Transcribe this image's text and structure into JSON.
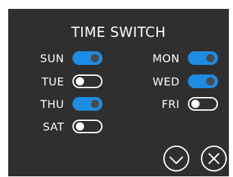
{
  "title": "TIME SWITCH",
  "days": [
    {
      "label": "SUN",
      "enabled": true
    },
    {
      "label": "MON",
      "enabled": true
    },
    {
      "label": "TUE",
      "enabled": false
    },
    {
      "label": "WED",
      "enabled": true
    },
    {
      "label": "THU",
      "enabled": true
    },
    {
      "label": "FRI",
      "enabled": false
    },
    {
      "label": "SAT",
      "enabled": false
    }
  ],
  "actions": {
    "confirm_icon": "check-circle-icon",
    "cancel_icon": "close-circle-icon"
  },
  "colors": {
    "panel": "#2f2f2f",
    "toggle_on": "#1e8ce2",
    "text": "#ffffff"
  }
}
